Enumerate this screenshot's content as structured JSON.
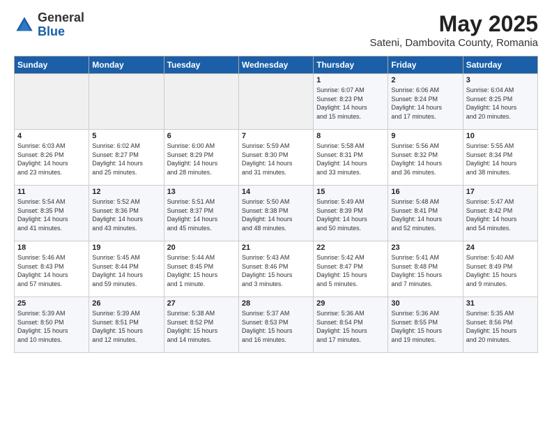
{
  "header": {
    "logo_general": "General",
    "logo_blue": "Blue",
    "month_year": "May 2025",
    "location": "Sateni, Dambovita County, Romania"
  },
  "days_of_week": [
    "Sunday",
    "Monday",
    "Tuesday",
    "Wednesday",
    "Thursday",
    "Friday",
    "Saturday"
  ],
  "weeks": [
    [
      {
        "day": "",
        "info": ""
      },
      {
        "day": "",
        "info": ""
      },
      {
        "day": "",
        "info": ""
      },
      {
        "day": "",
        "info": ""
      },
      {
        "day": "1",
        "info": "Sunrise: 6:07 AM\nSunset: 8:23 PM\nDaylight: 14 hours\nand 15 minutes."
      },
      {
        "day": "2",
        "info": "Sunrise: 6:06 AM\nSunset: 8:24 PM\nDaylight: 14 hours\nand 17 minutes."
      },
      {
        "day": "3",
        "info": "Sunrise: 6:04 AM\nSunset: 8:25 PM\nDaylight: 14 hours\nand 20 minutes."
      }
    ],
    [
      {
        "day": "4",
        "info": "Sunrise: 6:03 AM\nSunset: 8:26 PM\nDaylight: 14 hours\nand 23 minutes."
      },
      {
        "day": "5",
        "info": "Sunrise: 6:02 AM\nSunset: 8:27 PM\nDaylight: 14 hours\nand 25 minutes."
      },
      {
        "day": "6",
        "info": "Sunrise: 6:00 AM\nSunset: 8:29 PM\nDaylight: 14 hours\nand 28 minutes."
      },
      {
        "day": "7",
        "info": "Sunrise: 5:59 AM\nSunset: 8:30 PM\nDaylight: 14 hours\nand 31 minutes."
      },
      {
        "day": "8",
        "info": "Sunrise: 5:58 AM\nSunset: 8:31 PM\nDaylight: 14 hours\nand 33 minutes."
      },
      {
        "day": "9",
        "info": "Sunrise: 5:56 AM\nSunset: 8:32 PM\nDaylight: 14 hours\nand 36 minutes."
      },
      {
        "day": "10",
        "info": "Sunrise: 5:55 AM\nSunset: 8:34 PM\nDaylight: 14 hours\nand 38 minutes."
      }
    ],
    [
      {
        "day": "11",
        "info": "Sunrise: 5:54 AM\nSunset: 8:35 PM\nDaylight: 14 hours\nand 41 minutes."
      },
      {
        "day": "12",
        "info": "Sunrise: 5:52 AM\nSunset: 8:36 PM\nDaylight: 14 hours\nand 43 minutes."
      },
      {
        "day": "13",
        "info": "Sunrise: 5:51 AM\nSunset: 8:37 PM\nDaylight: 14 hours\nand 45 minutes."
      },
      {
        "day": "14",
        "info": "Sunrise: 5:50 AM\nSunset: 8:38 PM\nDaylight: 14 hours\nand 48 minutes."
      },
      {
        "day": "15",
        "info": "Sunrise: 5:49 AM\nSunset: 8:39 PM\nDaylight: 14 hours\nand 50 minutes."
      },
      {
        "day": "16",
        "info": "Sunrise: 5:48 AM\nSunset: 8:41 PM\nDaylight: 14 hours\nand 52 minutes."
      },
      {
        "day": "17",
        "info": "Sunrise: 5:47 AM\nSunset: 8:42 PM\nDaylight: 14 hours\nand 54 minutes."
      }
    ],
    [
      {
        "day": "18",
        "info": "Sunrise: 5:46 AM\nSunset: 8:43 PM\nDaylight: 14 hours\nand 57 minutes."
      },
      {
        "day": "19",
        "info": "Sunrise: 5:45 AM\nSunset: 8:44 PM\nDaylight: 14 hours\nand 59 minutes."
      },
      {
        "day": "20",
        "info": "Sunrise: 5:44 AM\nSunset: 8:45 PM\nDaylight: 15 hours\nand 1 minute."
      },
      {
        "day": "21",
        "info": "Sunrise: 5:43 AM\nSunset: 8:46 PM\nDaylight: 15 hours\nand 3 minutes."
      },
      {
        "day": "22",
        "info": "Sunrise: 5:42 AM\nSunset: 8:47 PM\nDaylight: 15 hours\nand 5 minutes."
      },
      {
        "day": "23",
        "info": "Sunrise: 5:41 AM\nSunset: 8:48 PM\nDaylight: 15 hours\nand 7 minutes."
      },
      {
        "day": "24",
        "info": "Sunrise: 5:40 AM\nSunset: 8:49 PM\nDaylight: 15 hours\nand 9 minutes."
      }
    ],
    [
      {
        "day": "25",
        "info": "Sunrise: 5:39 AM\nSunset: 8:50 PM\nDaylight: 15 hours\nand 10 minutes."
      },
      {
        "day": "26",
        "info": "Sunrise: 5:39 AM\nSunset: 8:51 PM\nDaylight: 15 hours\nand 12 minutes."
      },
      {
        "day": "27",
        "info": "Sunrise: 5:38 AM\nSunset: 8:52 PM\nDaylight: 15 hours\nand 14 minutes."
      },
      {
        "day": "28",
        "info": "Sunrise: 5:37 AM\nSunset: 8:53 PM\nDaylight: 15 hours\nand 16 minutes."
      },
      {
        "day": "29",
        "info": "Sunrise: 5:36 AM\nSunset: 8:54 PM\nDaylight: 15 hours\nand 17 minutes."
      },
      {
        "day": "30",
        "info": "Sunrise: 5:36 AM\nSunset: 8:55 PM\nDaylight: 15 hours\nand 19 minutes."
      },
      {
        "day": "31",
        "info": "Sunrise: 5:35 AM\nSunset: 8:56 PM\nDaylight: 15 hours\nand 20 minutes."
      }
    ]
  ]
}
